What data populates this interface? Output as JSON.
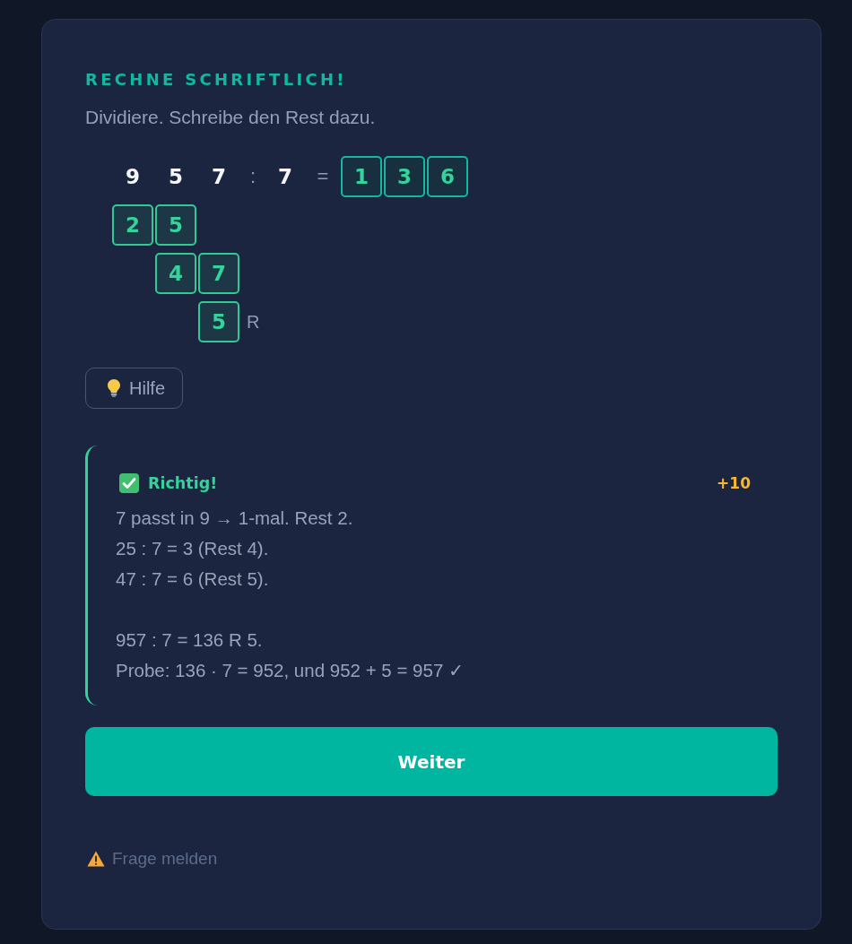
{
  "task": {
    "title": "RECHNE SCHRIFTLICH!",
    "instruction": "Dividiere. Schreibe den Rest dazu."
  },
  "division": {
    "dividend": [
      "9",
      "5",
      "7"
    ],
    "operator": ":",
    "divisor": "7",
    "equals": "=",
    "quotient": [
      "1",
      "3",
      "6"
    ],
    "steps": [
      {
        "digits": [
          "2",
          "5"
        ]
      },
      {
        "digits": [
          "4",
          "7"
        ]
      },
      {
        "digits": [
          "5"
        ],
        "suffix": "R"
      }
    ]
  },
  "hint_button": {
    "label": "Hilfe"
  },
  "feedback": {
    "correct": true,
    "title": "Richtig!",
    "points": "+10",
    "paragraphs": [
      [
        "7 passt in 9 → 1-mal. Rest 2.",
        "25 : 7 = 3 (Rest 4).",
        "47 : 7 = 6 (Rest 5)."
      ],
      [
        "957 : 7 = 136 R 5.",
        "Probe: 136 · 7 = 952, und 952 + 5 = 957 ✓"
      ]
    ]
  },
  "continue_button": {
    "label": "Weiter"
  },
  "report_link": {
    "label": "Frage melden"
  }
}
